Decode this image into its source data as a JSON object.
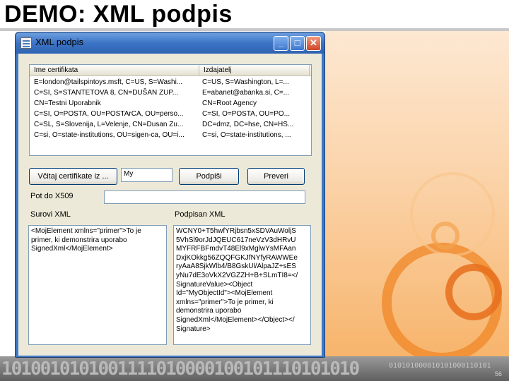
{
  "slide": {
    "title": "DEMO: XML podpis",
    "binary_footer": "1010010101001111010000100101110101010",
    "binary_small": "010101000010101000110101",
    "page_number": "56"
  },
  "window": {
    "title": "XML podpis",
    "caption_buttons": {
      "minimize": "_",
      "maximize": "□",
      "close": "✕"
    }
  },
  "certificates": {
    "columns": [
      "Ime certifikata",
      "Izdajatelj"
    ],
    "rows": [
      [
        "E=london@tailspintoys.msft, C=US, S=Washi...",
        "C=US, S=Washington, L=..."
      ],
      [
        "C=SI, S=STANTETOVA 8, CN=DUŠAN ZUP...",
        "E=abanet@abanka.si, C=..."
      ],
      [
        "CN=Testni Uporabnik",
        "CN=Root Agency"
      ],
      [
        "C=SI, O=POSTA, OU=POSTArCA, OU=perso...",
        "C=SI, O=POSTA, OU=PO..."
      ],
      [
        "C=SL, S=Slovenija, L=Velenje, CN=Dusan Zu...",
        "DC=dmz, DC=hse, CN=HS..."
      ],
      [
        "C=si, O=state-institutions, OU=sigen-ca, OU=i...",
        "C=si, O=state-institutions, ..."
      ]
    ]
  },
  "controls": {
    "load_button": "Včitaj certifikate iz ...",
    "store_value": "My",
    "sign_button": "Podpiši",
    "verify_button": "Preveri",
    "path_label": "Pot do X509",
    "path_value": "",
    "raw_label": "Surovi XML",
    "signed_label": "Podpisan XML"
  },
  "raw_xml": [
    "<MojElement xmlns=\"primer\">To je",
    "primer, ki demonstrira uporabo",
    "SignedXml</MojElement>"
  ],
  "signed_xml": [
    "WCNY0+T5hwfYRjbsn5xSDVAuWoljS",
    "5VhSl9orJdJQEUC617neVzV3dHRvU",
    "MYFRFBFmdvT48El9xMglwYsMFAan",
    "DxjKOkkg56ZQQFGKJfNYfyRAWWEe",
    "ryAaA8SjkWlb4/B8GskUl/AlpaJZ+sES",
    "yNu7dE3oVkX2VGZZH+B+SLmTI8=</",
    "SignatureValue><Object",
    "Id=\"MyObjectId\"><MojElement",
    "xmlns=\"primer\">To je primer, ki",
    "demonstrira uporabo",
    "SignedXml</MojElement></Object></",
    "Signature>"
  ]
}
